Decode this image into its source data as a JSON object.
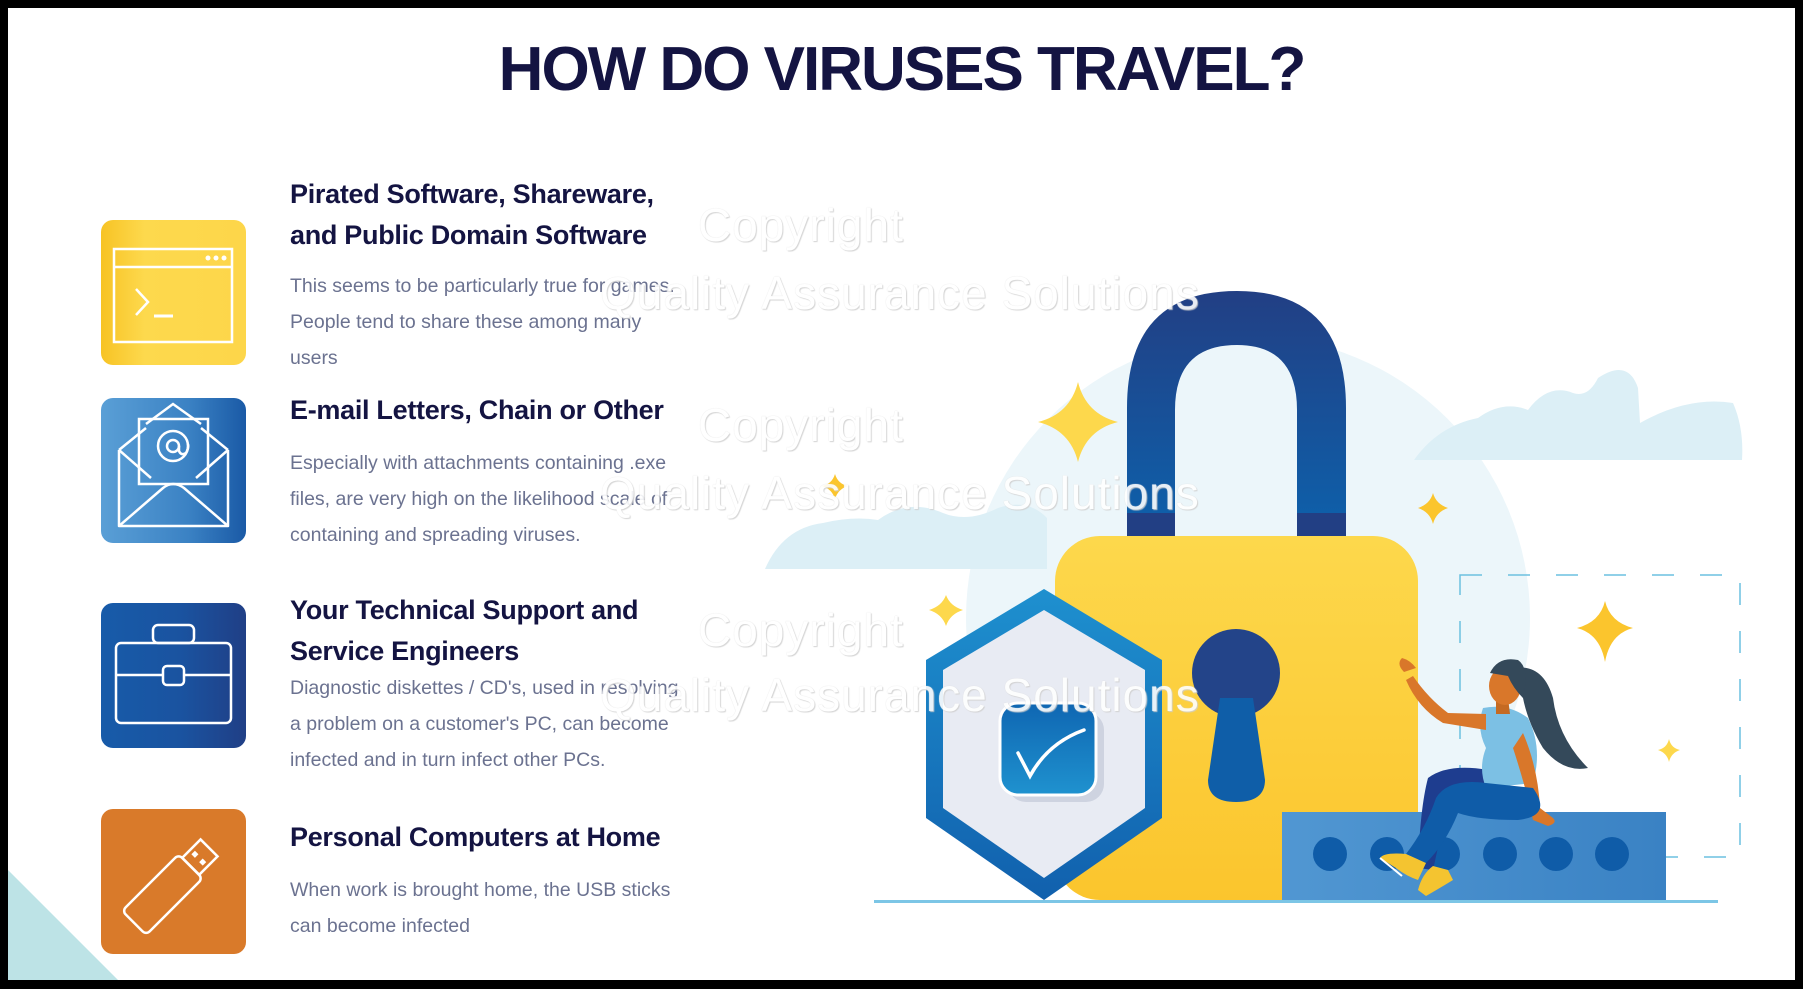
{
  "slide": {
    "title": "HOW DO VIRUSES TRAVEL?",
    "items": [
      {
        "icon": "terminal-window-icon",
        "icon_color": "#fdd64a",
        "heading_lines": [
          "Pirated Software, Shareware,",
          "and Public Domain Software"
        ],
        "body_lines": [
          "This seems to be particularly true for games.",
          "People tend to share these among many",
          "users"
        ]
      },
      {
        "icon": "email-envelope-icon",
        "icon_color": "#3a86c8",
        "heading_lines": [
          "E-mail Letters, Chain or Other"
        ],
        "body_lines": [
          "Especially with attachments containing .exe",
          "files, are very high on the likelihood scale of",
          "containing and spreading viruses."
        ]
      },
      {
        "icon": "briefcase-icon",
        "icon_color": "#1a53a0",
        "heading_lines": [
          "Your Technical Support and",
          "Service Engineers"
        ],
        "body_lines": [
          "Diagnostic diskettes / CD's, used in resolving",
          "a problem on a customer's PC, can become",
          "infected and in turn infect other PCs."
        ]
      },
      {
        "icon": "usb-stick-icon",
        "icon_color": "#d97a2a",
        "heading_lines": [
          "Personal Computers at Home"
        ],
        "body_lines": [
          "When work is brought home, the USB sticks",
          "can become infected"
        ]
      }
    ],
    "watermark": {
      "line1": "Copyright",
      "line2": "Quality Assurance Solutions"
    }
  },
  "colors": {
    "title": "#141442",
    "body_text": "#6b7290",
    "lock_body": "#fdd64a",
    "shackle": "#1f4f9a",
    "shield": "#1e8fcf",
    "bench": "#4a90cc",
    "accent_star": "#fbc52d"
  }
}
